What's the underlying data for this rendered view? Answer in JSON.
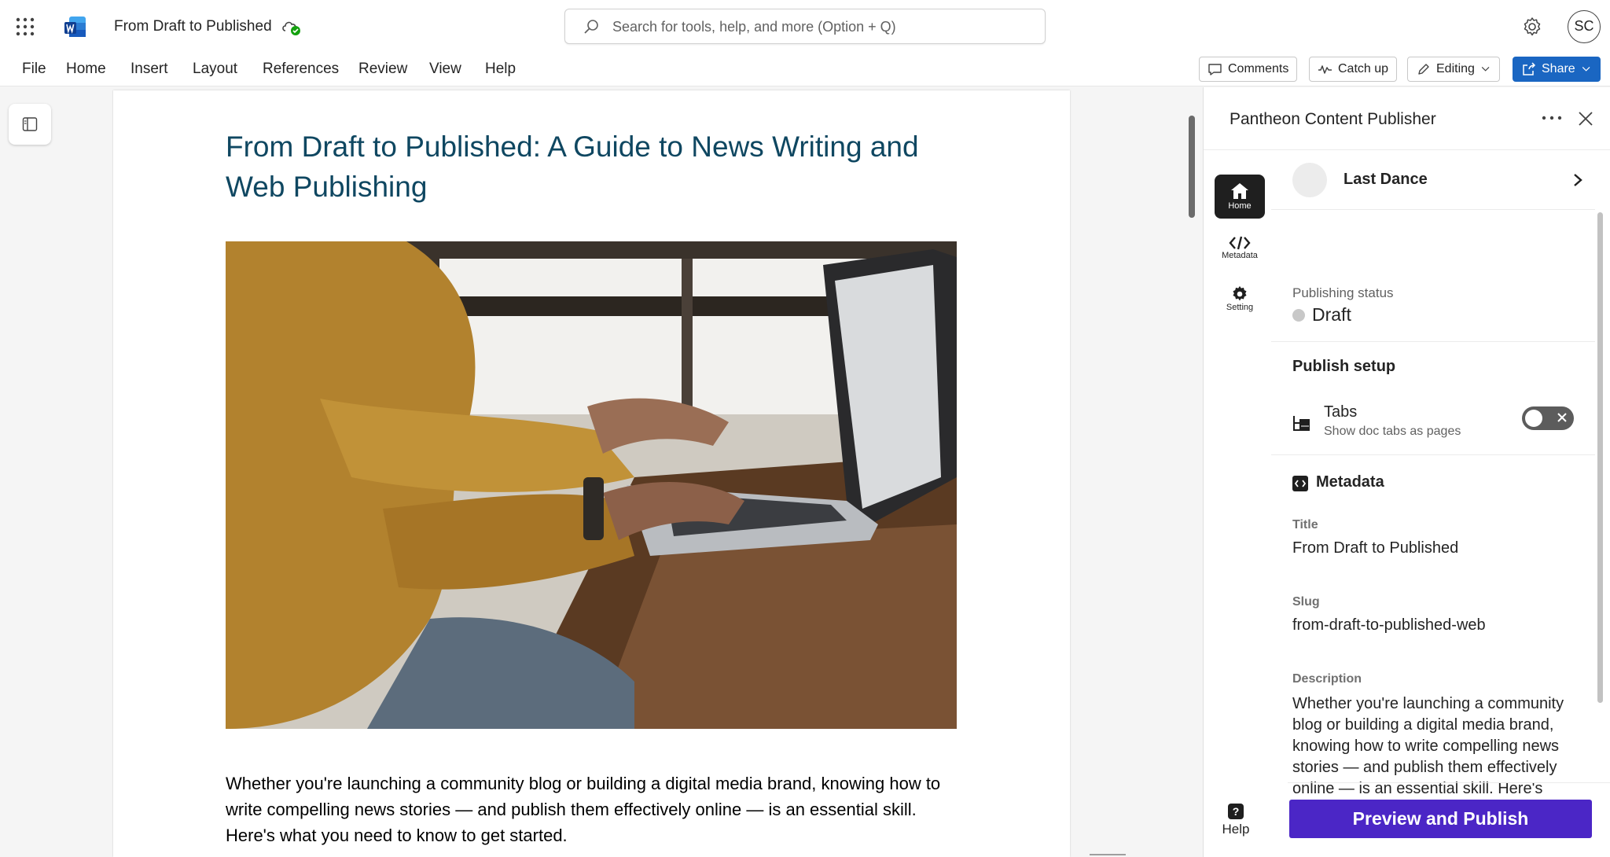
{
  "app": {
    "doc_title": "From Draft to Published",
    "search_placeholder": "Search for tools, help, and more (Option + Q)",
    "user_initials": "SC"
  },
  "ribbon": {
    "menus": [
      "File",
      "Home",
      "Insert",
      "Layout",
      "References",
      "Review",
      "View",
      "Help"
    ],
    "comments_label": "Comments",
    "catchup_label": "Catch up",
    "editing_label": "Editing",
    "share_label": "Share"
  },
  "document": {
    "heading": "From Draft to Published: A Guide to News Writing and Web Publishing",
    "body": "Whether you're launching a community blog or building a digital media brand, knowing how to write compelling news stories — and publish them effectively online — is an essential skill. Here's what you need to know to get started."
  },
  "panel": {
    "title": "Pantheon Content Publisher",
    "rail": {
      "home": "Home",
      "metadata": "Metadata",
      "setting": "Setting",
      "help": "Help"
    },
    "site_name": "Last Dance",
    "publishing_status_label": "Publishing status",
    "publishing_status_value": "Draft",
    "publish_setup_heading": "Publish setup",
    "tabs_title": "Tabs",
    "tabs_subtitle": "Show doc tabs as pages",
    "tabs_enabled": false,
    "metadata_heading": "Metadata",
    "fields": {
      "title_label": "Title",
      "title_value": "From Draft to Published",
      "slug_label": "Slug",
      "slug_value": "from-draft-to-published-web",
      "description_label": "Description",
      "description_value": "Whether you're launching a community blog or building a digital media brand, knowing how to write compelling news stories — and publish them effectively online — is an essential skill. Here's what you need to know to get started."
    },
    "publish_button": "Preview and Publish",
    "accent_color": "#4b26c6"
  },
  "colors": {
    "heading": "#0f4761",
    "share": "#1a66c2"
  }
}
